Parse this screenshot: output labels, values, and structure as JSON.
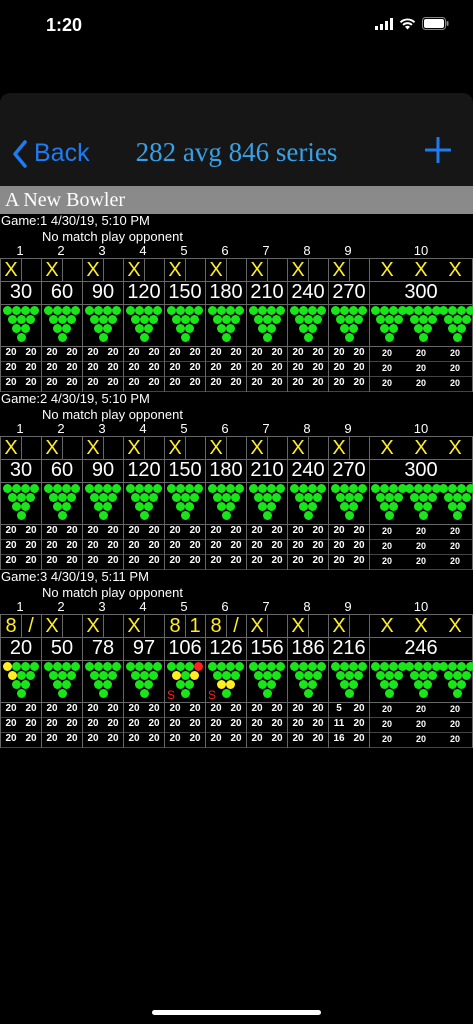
{
  "status": {
    "time": "1:20"
  },
  "nav": {
    "back_label": "Back",
    "title": "282 avg 846 series",
    "add_label": "+"
  },
  "bowler": {
    "name": "A New Bowler"
  },
  "frame_numbers": [
    "1",
    "2",
    "3",
    "4",
    "5",
    "6",
    "7",
    "8",
    "9",
    "10"
  ],
  "games": [
    {
      "header": "Game:1   4/30/19, 5:10 PM",
      "opponent": "No match play opponent",
      "rolls": [
        [
          "X",
          ""
        ],
        [
          "X",
          ""
        ],
        [
          "X",
          ""
        ],
        [
          "X",
          ""
        ],
        [
          "X",
          ""
        ],
        [
          "X",
          ""
        ],
        [
          "X",
          ""
        ],
        [
          "X",
          ""
        ],
        [
          "X",
          ""
        ],
        [
          "X",
          "X",
          "X"
        ]
      ],
      "scores": [
        "30",
        "60",
        "90",
        "120",
        "150",
        "180",
        "210",
        "240",
        "270",
        "300"
      ],
      "pins": [
        [],
        [],
        [],
        [],
        [],
        [],
        [],
        [],
        [],
        [
          [],
          [],
          []
        ]
      ],
      "splits": [],
      "stats": [
        [
          [
            "20",
            "20"
          ],
          [
            "20",
            "20"
          ],
          [
            "20",
            "20"
          ],
          [
            "20",
            "20"
          ],
          [
            "20",
            "20"
          ],
          [
            "20",
            "20"
          ],
          [
            "20",
            "20"
          ],
          [
            "20",
            "20"
          ],
          [
            "20",
            "20"
          ],
          [
            "20",
            "20",
            "20"
          ]
        ],
        [
          [
            "20",
            "20"
          ],
          [
            "20",
            "20"
          ],
          [
            "20",
            "20"
          ],
          [
            "20",
            "20"
          ],
          [
            "20",
            "20"
          ],
          [
            "20",
            "20"
          ],
          [
            "20",
            "20"
          ],
          [
            "20",
            "20"
          ],
          [
            "20",
            "20"
          ],
          [
            "20",
            "20",
            "20"
          ]
        ],
        [
          [
            "20",
            "20"
          ],
          [
            "20",
            "20"
          ],
          [
            "20",
            "20"
          ],
          [
            "20",
            "20"
          ],
          [
            "20",
            "20"
          ],
          [
            "20",
            "20"
          ],
          [
            "20",
            "20"
          ],
          [
            "20",
            "20"
          ],
          [
            "20",
            "20"
          ],
          [
            "20",
            "20",
            "20"
          ]
        ]
      ]
    },
    {
      "header": "Game:2   4/30/19, 5:10 PM",
      "opponent": "No match play opponent",
      "rolls": [
        [
          "X",
          ""
        ],
        [
          "X",
          ""
        ],
        [
          "X",
          ""
        ],
        [
          "X",
          ""
        ],
        [
          "X",
          ""
        ],
        [
          "X",
          ""
        ],
        [
          "X",
          ""
        ],
        [
          "X",
          ""
        ],
        [
          "X",
          ""
        ],
        [
          "X",
          "X",
          "X"
        ]
      ],
      "scores": [
        "30",
        "60",
        "90",
        "120",
        "150",
        "180",
        "210",
        "240",
        "270",
        "300"
      ],
      "pins": [
        [],
        [],
        [],
        [],
        [],
        [],
        [],
        [],
        [],
        [
          [],
          [],
          []
        ]
      ],
      "splits": [],
      "stats": [
        [
          [
            "20",
            "20"
          ],
          [
            "20",
            "20"
          ],
          [
            "20",
            "20"
          ],
          [
            "20",
            "20"
          ],
          [
            "20",
            "20"
          ],
          [
            "20",
            "20"
          ],
          [
            "20",
            "20"
          ],
          [
            "20",
            "20"
          ],
          [
            "20",
            "20"
          ],
          [
            "20",
            "20",
            "20"
          ]
        ],
        [
          [
            "20",
            "20"
          ],
          [
            "20",
            "20"
          ],
          [
            "20",
            "20"
          ],
          [
            "20",
            "20"
          ],
          [
            "20",
            "20"
          ],
          [
            "20",
            "20"
          ],
          [
            "20",
            "20"
          ],
          [
            "20",
            "20"
          ],
          [
            "20",
            "20"
          ],
          [
            "20",
            "20",
            "20"
          ]
        ],
        [
          [
            "20",
            "20"
          ],
          [
            "20",
            "20"
          ],
          [
            "20",
            "20"
          ],
          [
            "20",
            "20"
          ],
          [
            "20",
            "20"
          ],
          [
            "20",
            "20"
          ],
          [
            "20",
            "20"
          ],
          [
            "20",
            "20"
          ],
          [
            "20",
            "20"
          ],
          [
            "20",
            "20",
            "20"
          ]
        ]
      ]
    },
    {
      "header": "Game:3   4/30/19, 5:11 PM",
      "opponent": "No match play opponent",
      "rolls": [
        [
          "8",
          "/"
        ],
        [
          "X",
          ""
        ],
        [
          "X",
          ""
        ],
        [
          "X",
          ""
        ],
        [
          "8",
          "1"
        ],
        [
          "8",
          "/"
        ],
        [
          "X",
          ""
        ],
        [
          "X",
          ""
        ],
        [
          "X",
          ""
        ],
        [
          "X",
          "X",
          "X"
        ]
      ],
      "scores": [
        "20",
        "50",
        "78",
        "97",
        "106",
        "126",
        "156",
        "186",
        "216",
        "246"
      ],
      "pins": [
        [
          4,
          7
        ],
        [],
        [],
        [],
        [
          4,
          6
        ],
        [
          2,
          3
        ],
        [],
        [],
        [],
        [
          [],
          [],
          []
        ]
      ],
      "pins_red": [
        [],
        [],
        [],
        [],
        [
          10
        ],
        [],
        [],
        [],
        [],
        []
      ],
      "splits": [
        "",
        "",
        "",
        "",
        "S",
        "S",
        "",
        "",
        "",
        ""
      ],
      "stats": [
        [
          [
            "20",
            "20"
          ],
          [
            "20",
            "20"
          ],
          [
            "20",
            "20"
          ],
          [
            "20",
            "20"
          ],
          [
            "20",
            "20"
          ],
          [
            "20",
            "20"
          ],
          [
            "20",
            "20"
          ],
          [
            "20",
            "20"
          ],
          [
            "5",
            "20"
          ],
          [
            "20",
            "20",
            "20"
          ]
        ],
        [
          [
            "20",
            "20"
          ],
          [
            "20",
            "20"
          ],
          [
            "20",
            "20"
          ],
          [
            "20",
            "20"
          ],
          [
            "20",
            "20"
          ],
          [
            "20",
            "20"
          ],
          [
            "20",
            "20"
          ],
          [
            "20",
            "20"
          ],
          [
            "11",
            "20"
          ],
          [
            "20",
            "20",
            "20"
          ]
        ],
        [
          [
            "20",
            "20"
          ],
          [
            "20",
            "20"
          ],
          [
            "20",
            "20"
          ],
          [
            "20",
            "20"
          ],
          [
            "20",
            "20"
          ],
          [
            "20",
            "20"
          ],
          [
            "20",
            "20"
          ],
          [
            "20",
            "20"
          ],
          [
            "16",
            "20"
          ],
          [
            "20",
            "20",
            "20"
          ]
        ]
      ]
    }
  ],
  "colors": {
    "accent": "#1e7cf2",
    "title": "#3aa0e6",
    "pin": "#19e619",
    "mark": "#ffee22",
    "split": "#ff2020",
    "header_bar": "#8a8a8a"
  }
}
